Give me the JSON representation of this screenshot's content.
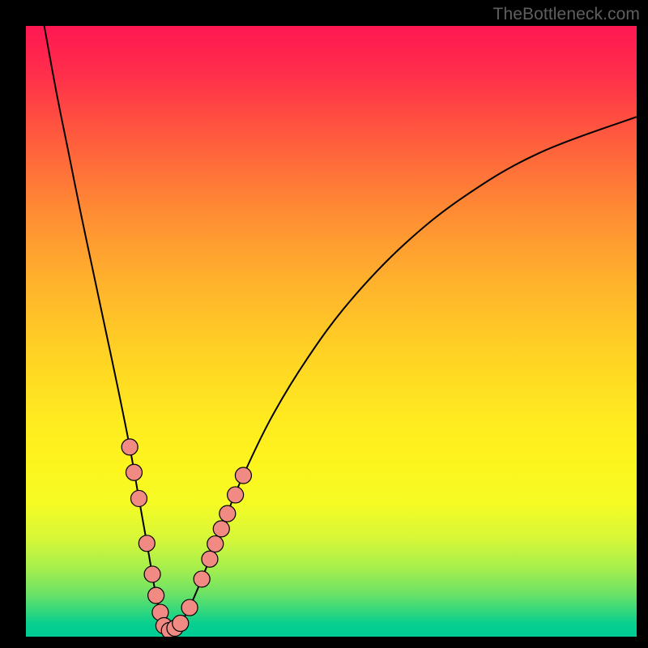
{
  "watermark": "TheBottleneck.com",
  "colors": {
    "gradient_top": "#ff1752",
    "gradient_bottom": "#00cc94",
    "curve": "#000000",
    "bead_fill": "#f28a84",
    "bead_stroke": "#000000",
    "frame_bg": "#000000"
  },
  "chart_data": {
    "type": "line",
    "title": "",
    "xlabel": "",
    "ylabel": "",
    "xlim": [
      0,
      100
    ],
    "ylim": [
      0,
      100
    ],
    "curve": {
      "comment": "V-shaped bottleneck curve: x in [0,100] share of axis width, y = mismatch % (100 at top, 0 at bottom). Two smooth branches meeting at the minimum near x≈23.",
      "left_branch": [
        {
          "x": 3.0,
          "y": 100.0
        },
        {
          "x": 5.0,
          "y": 89.0
        },
        {
          "x": 7.0,
          "y": 79.0
        },
        {
          "x": 9.0,
          "y": 69.0
        },
        {
          "x": 11.0,
          "y": 59.5
        },
        {
          "x": 13.0,
          "y": 50.0
        },
        {
          "x": 15.0,
          "y": 40.5
        },
        {
          "x": 17.0,
          "y": 30.5
        },
        {
          "x": 18.5,
          "y": 22.0
        },
        {
          "x": 20.0,
          "y": 13.5
        },
        {
          "x": 21.3,
          "y": 6.0
        },
        {
          "x": 22.4,
          "y": 1.5
        },
        {
          "x": 23.5,
          "y": 0.2
        }
      ],
      "right_branch": [
        {
          "x": 23.5,
          "y": 0.2
        },
        {
          "x": 25.0,
          "y": 1.0
        },
        {
          "x": 27.0,
          "y": 4.5
        },
        {
          "x": 29.5,
          "y": 10.5
        },
        {
          "x": 32.0,
          "y": 17.0
        },
        {
          "x": 35.0,
          "y": 24.5
        },
        {
          "x": 40.0,
          "y": 35.0
        },
        {
          "x": 46.0,
          "y": 45.0
        },
        {
          "x": 53.0,
          "y": 54.5
        },
        {
          "x": 62.0,
          "y": 64.0
        },
        {
          "x": 72.0,
          "y": 72.0
        },
        {
          "x": 84.0,
          "y": 79.0
        },
        {
          "x": 100.0,
          "y": 85.0
        }
      ]
    },
    "beads": {
      "comment": "Highlighted sample points (salmon dots) near the minimum on both branches.",
      "r": 10,
      "points": [
        {
          "x": 17.0,
          "y": 30.5
        },
        {
          "x": 17.7,
          "y": 26.3
        },
        {
          "x": 18.5,
          "y": 22.0
        },
        {
          "x": 19.8,
          "y": 14.6
        },
        {
          "x": 20.7,
          "y": 9.5
        },
        {
          "x": 21.3,
          "y": 6.0
        },
        {
          "x": 22.0,
          "y": 3.2
        },
        {
          "x": 22.6,
          "y": 1.0
        },
        {
          "x": 23.5,
          "y": 0.2
        },
        {
          "x": 24.4,
          "y": 0.6
        },
        {
          "x": 25.3,
          "y": 1.4
        },
        {
          "x": 26.8,
          "y": 4.0
        },
        {
          "x": 28.8,
          "y": 8.7
        },
        {
          "x": 30.1,
          "y": 12.0
        },
        {
          "x": 31.0,
          "y": 14.5
        },
        {
          "x": 32.0,
          "y": 17.0
        },
        {
          "x": 33.0,
          "y": 19.5
        },
        {
          "x": 34.3,
          "y": 22.6
        },
        {
          "x": 35.6,
          "y": 25.8
        }
      ]
    }
  }
}
